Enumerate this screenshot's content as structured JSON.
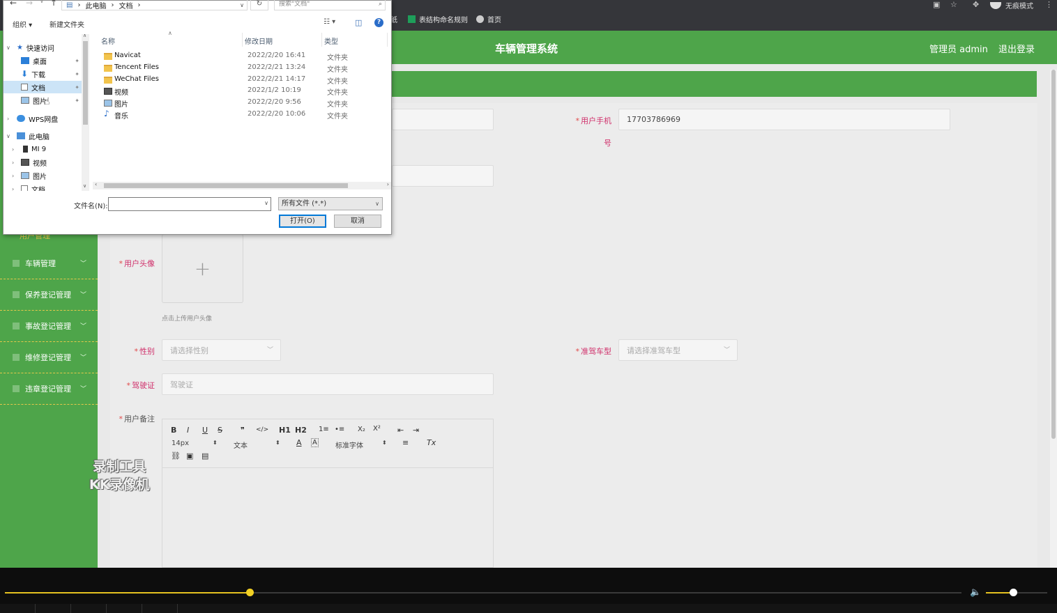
{
  "browser": {
    "bookmarks": [
      {
        "label": "纸",
        "icon": "bookmark-partial-icon"
      },
      {
        "label": "表结构命名规则",
        "icon": "sheet-icon"
      },
      {
        "label": "首页",
        "icon": "globe-icon"
      }
    ],
    "incognito_label": "无痕模式"
  },
  "app": {
    "title": "车辆管理系统",
    "admin_label": "管理员 admin",
    "logout_label": "退出登录",
    "accent_color": "#4ea54a"
  },
  "sidebar": {
    "partial_label": "用户管理",
    "items": [
      {
        "label": "车辆管理"
      },
      {
        "label": "保养登记管理"
      },
      {
        "label": "事故登记管理"
      },
      {
        "label": "维修登记管理"
      },
      {
        "label": "违章登记管理"
      }
    ]
  },
  "form": {
    "phone": {
      "label": "用户手机号",
      "label_line1": "用户手机",
      "label_line2": "号",
      "value": "17703786969"
    },
    "avatar": {
      "label": "用户头像",
      "hint": "点击上传用户头像"
    },
    "gender": {
      "label": "性别",
      "placeholder": "请选择性别"
    },
    "license_type": {
      "label": "准驾车型",
      "placeholder": "请选择准驾车型"
    },
    "license": {
      "label": "驾驶证",
      "placeholder": "驾驶证"
    },
    "remark": {
      "label": "用户备注"
    }
  },
  "editor": {
    "font_size": "14px",
    "header_style": "文本",
    "font_family": "标准字体",
    "tools": [
      "B",
      "I",
      "U",
      "S",
      "❞",
      "</>",
      "H1",
      "H2",
      "1≡",
      "•≡",
      "X₂",
      "X²",
      "⇤",
      "⇥",
      "A",
      "A",
      "≡",
      "Tx"
    ]
  },
  "watermark": {
    "line1": "录制工具",
    "line2": "KK录像机"
  },
  "file_dialog": {
    "path": [
      "此电脑",
      "文档"
    ],
    "search_placeholder": "搜索\"文档\"",
    "organize_label": "组织 ▾",
    "new_folder_label": "新建文件夹",
    "nav": [
      {
        "label": "快速访问",
        "level": 0,
        "icon": "star-icon",
        "expand": "v"
      },
      {
        "label": "桌面",
        "level": 1,
        "icon": "desktop-icon",
        "pin": true
      },
      {
        "label": "下载",
        "level": 1,
        "icon": "download-icon",
        "pin": true
      },
      {
        "label": "文档",
        "level": 1,
        "icon": "document-icon",
        "pin": true,
        "selected": true
      },
      {
        "label": "图片",
        "level": 1,
        "icon": "picture-icon",
        "pin": true
      },
      {
        "label": "WPS网盘",
        "level": 0,
        "icon": "cloud-icon",
        "expand": ">"
      },
      {
        "label": "此电脑",
        "level": 0,
        "icon": "computer-icon",
        "expand": "v"
      },
      {
        "label": "MI 9",
        "level": 1,
        "icon": "phone-icon",
        "expand": ">"
      },
      {
        "label": "视频",
        "level": 1,
        "icon": "video-icon",
        "expand": ">"
      },
      {
        "label": "图片",
        "level": 1,
        "icon": "picture-icon",
        "expand": ">"
      },
      {
        "label": "文档",
        "level": 1,
        "icon": "document-icon",
        "expand": ">"
      }
    ],
    "columns": {
      "name": "名称",
      "date": "修改日期",
      "type": "类型"
    },
    "files": [
      {
        "name": "Navicat",
        "date": "2022/2/20 16:41",
        "type": "文件夹",
        "icon": "folder-icon"
      },
      {
        "name": "Tencent Files",
        "date": "2022/2/21 13:24",
        "type": "文件夹",
        "icon": "folder-icon"
      },
      {
        "name": "WeChat Files",
        "date": "2022/2/21 14:17",
        "type": "文件夹",
        "icon": "folder-icon"
      },
      {
        "name": "视频",
        "date": "2022/1/2 10:19",
        "type": "文件夹",
        "icon": "video-folder-icon"
      },
      {
        "name": "图片",
        "date": "2022/2/20 9:56",
        "type": "文件夹",
        "icon": "picture-folder-icon"
      },
      {
        "name": "音乐",
        "date": "2022/2/20 10:06",
        "type": "文件夹",
        "icon": "music-folder-icon"
      }
    ],
    "filename_label": "文件名(N):",
    "filename_value": "",
    "filetype_value": "所有文件 (*.*)",
    "open_label": "打开(O)",
    "cancel_label": "取消"
  },
  "player": {
    "progress": 0.256,
    "volume": 0.44,
    "accent_color": "#e6c220"
  }
}
